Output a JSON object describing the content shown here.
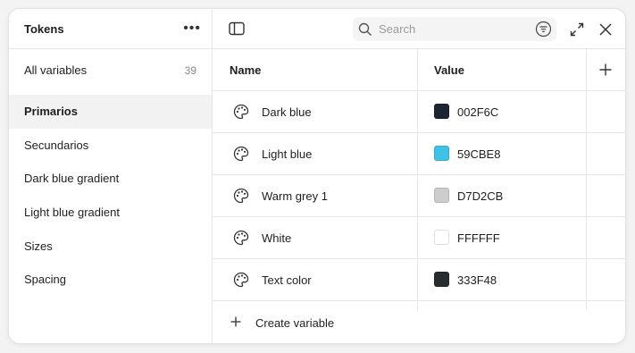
{
  "sidebar": {
    "title": "Tokens",
    "more_label": "•••",
    "all_variables": {
      "label": "All variables",
      "count": "39"
    },
    "collections": [
      {
        "label": "Primarios",
        "selected": true
      },
      {
        "label": "Secundarios",
        "selected": false
      },
      {
        "label": "Dark blue gradient",
        "selected": false
      },
      {
        "label": "Light blue gradient",
        "selected": false
      },
      {
        "label": "Sizes",
        "selected": false
      },
      {
        "label": "Spacing",
        "selected": false
      }
    ]
  },
  "toolbar": {
    "search_placeholder": "Search",
    "icons": [
      "sidebar-toggle-icon",
      "search-icon",
      "filter-icon",
      "expand-icon",
      "close-icon"
    ]
  },
  "table": {
    "columns": {
      "name": "Name",
      "value": "Value"
    },
    "rows": [
      {
        "name": "Dark blue",
        "hex": "002F6C",
        "color": "#1d2532"
      },
      {
        "name": "Light blue",
        "hex": "59CBE8",
        "color": "#3ec2e6"
      },
      {
        "name": "Warm grey 1",
        "hex": "D7D2CB",
        "color": "#cdcdcd"
      },
      {
        "name": "White",
        "hex": "FFFFFF",
        "color": "#ffffff"
      },
      {
        "name": "Text color",
        "hex": "333F48",
        "color": "#2a2a31"
      }
    ],
    "create_label": "Create variable"
  }
}
